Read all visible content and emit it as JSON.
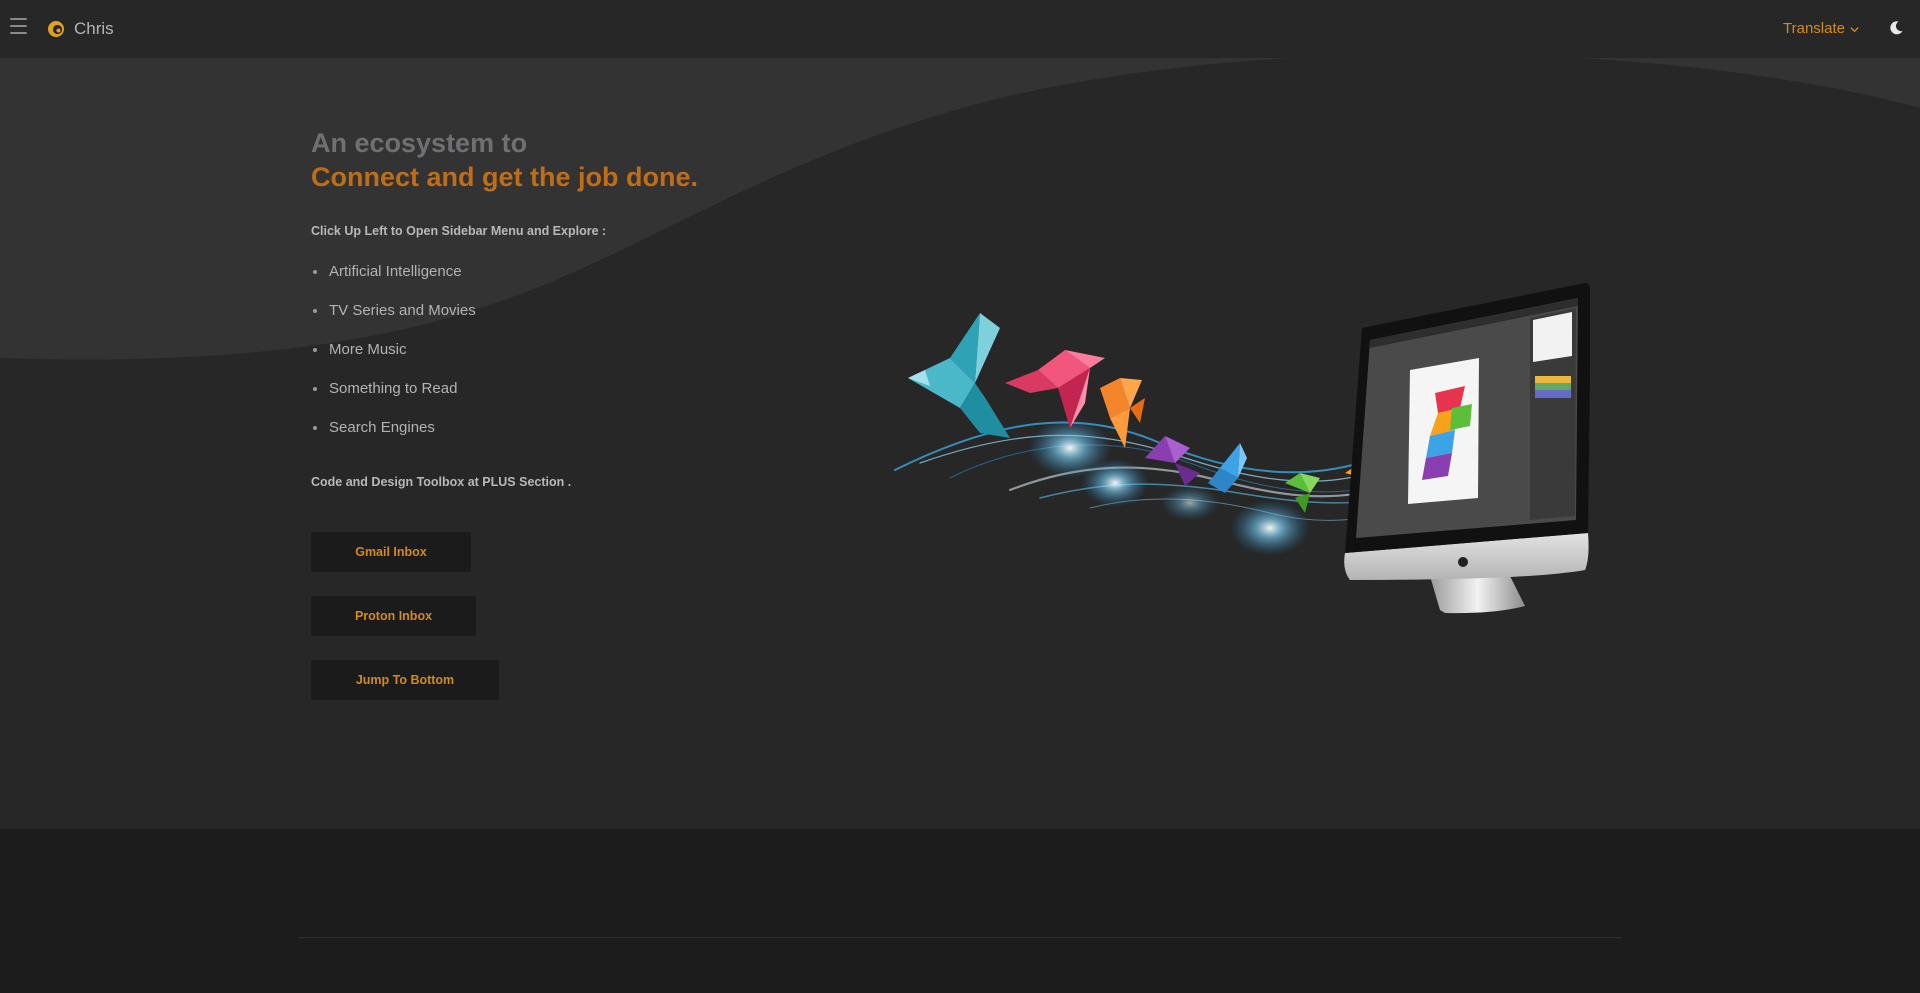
{
  "header": {
    "brand_name": "Chris",
    "translate_label": "Translate",
    "menu_icon": "hamburger-icon",
    "theme_icon": "moon-icon"
  },
  "hero": {
    "headline_line1": "An ecosystem to",
    "headline_line2": "Connect and get the job done.",
    "intro": "Click Up Left to Open Sidebar Menu and Explore :",
    "topics": [
      "Artificial Intelligence",
      "TV Series and Movies",
      "More Music",
      "Something to Read",
      "Search Engines"
    ],
    "toolbox_note": "Code and Design Toolbox at PLUS Section .",
    "buttons": {
      "gmail": "Gmail Inbox",
      "proton": "Proton Inbox",
      "jump": "Jump To Bottom"
    }
  },
  "colors": {
    "accent": "#d38a1c",
    "headline_accent": "#c06d17",
    "background": "#272727",
    "footer": "#1c1c1c"
  }
}
